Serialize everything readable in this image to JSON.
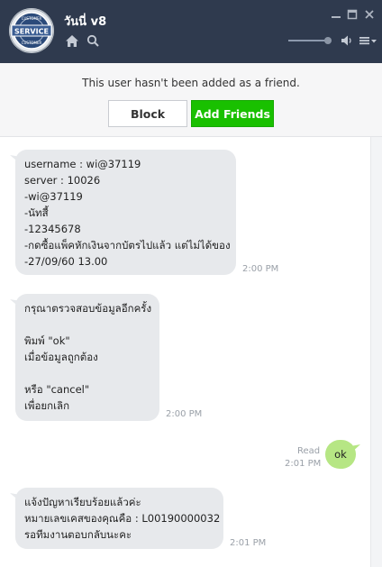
{
  "header": {
    "title": "วันนี่ v8",
    "avatar_text_top": "CUSTOMER",
    "avatar_text_mid": "SERVICE",
    "avatar_text_bottom": "CUSTOMER",
    "home_icon": "home-icon",
    "search_icon": "search-icon",
    "minimize_icon": "minimize-icon",
    "maximize_icon": "maximize-icon",
    "close_icon": "close-icon",
    "volume_icon": "volume-icon",
    "menu_icon": "menu-icon",
    "volume_level": 0.92,
    "bg_color": "#2f3a4e"
  },
  "banner": {
    "text": "This user hasn't been added as a friend.",
    "block_label": "Block",
    "add_label": "Add Friends",
    "add_color": "#19c000"
  },
  "messages": [
    {
      "direction": "in",
      "lines": [
        "username : wi@37119",
        "server : 10026",
        "-wi@37119",
        "-นัทสี้",
        "-12345678",
        "-กดซื้อแพ็คหักเงินจากบัตรไปแล้ว แต่ไม่ได้ของ",
        "-27/09/60 13.00"
      ],
      "time": "2:00 PM"
    },
    {
      "direction": "in",
      "lines": [
        "กรุณาตรวจสอบข้อมูลอีกครั้ง",
        "",
        "พิมพ์ \"ok\"",
        "เมื่อข้อมูลถูกต้อง",
        "",
        "หรือ \"cancel\"",
        "เพื่อยกเลิก"
      ],
      "time": "2:00 PM"
    },
    {
      "direction": "out",
      "text": "ok",
      "status": "Read",
      "time": "2:01 PM"
    },
    {
      "direction": "in",
      "lines": [
        "แจ้งปัญหาเรียบร้อยแล้วค่ะ",
        "หมายเลขเคสของคุณคือ : L00190000032",
        "รอทีมงานตอบกลับนะคะ"
      ],
      "time": "2:01 PM"
    }
  ],
  "colors": {
    "incoming_bubble": "#e7e9ec",
    "outgoing_bubble": "#b6e684"
  }
}
